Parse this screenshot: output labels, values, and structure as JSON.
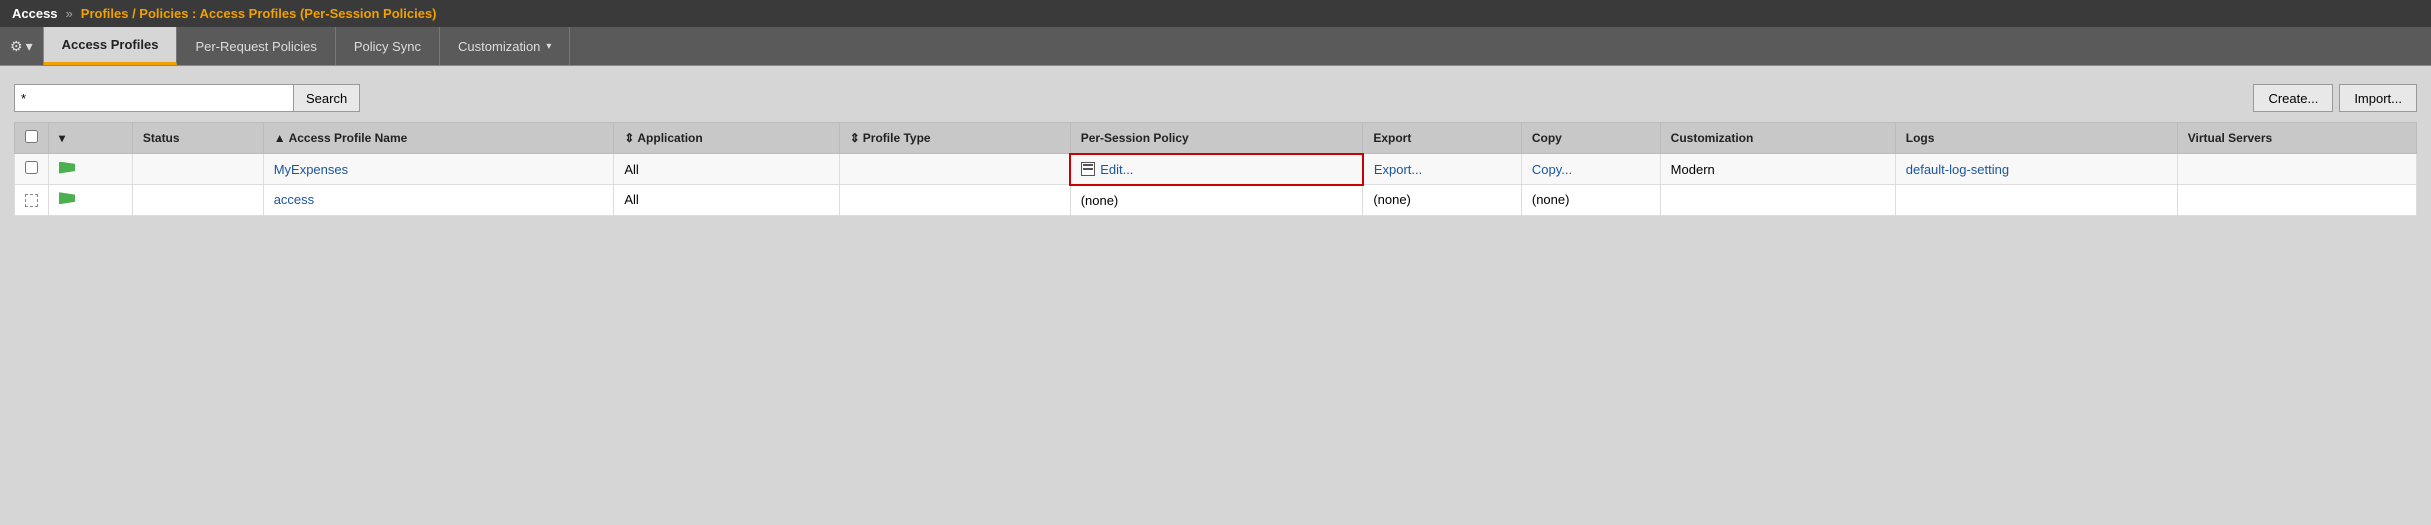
{
  "header": {
    "app_label": "Access",
    "chevrons": "»",
    "breadcrumb": "Profiles / Policies : Access Profiles (Per-Session Policies)"
  },
  "tabs": {
    "gear_label": "⚙",
    "dropdown_arrow": "▾",
    "items": [
      {
        "id": "access-profiles",
        "label": "Access Profiles",
        "active": true
      },
      {
        "id": "per-request-policies",
        "label": "Per-Request Policies",
        "active": false
      },
      {
        "id": "policy-sync",
        "label": "Policy Sync",
        "active": false
      },
      {
        "id": "customization",
        "label": "Customization",
        "active": false,
        "has_dropdown": true
      }
    ]
  },
  "search": {
    "input_value": "*",
    "input_placeholder": "",
    "search_button_label": "Search",
    "create_button_label": "Create...",
    "import_button_label": "Import..."
  },
  "table": {
    "columns": [
      {
        "id": "checkbox",
        "label": ""
      },
      {
        "id": "dropdown",
        "label": ""
      },
      {
        "id": "status",
        "label": "Status",
        "sortable": false
      },
      {
        "id": "access-profile-name",
        "label": "Access Profile Name",
        "sortable": true,
        "sort_dir": "asc"
      },
      {
        "id": "application",
        "label": "Application",
        "sortable": true,
        "sort_dir": ""
      },
      {
        "id": "profile-type",
        "label": "Profile Type",
        "sortable": true,
        "sort_dir": ""
      },
      {
        "id": "per-session-policy",
        "label": "Per-Session Policy",
        "sortable": false
      },
      {
        "id": "export",
        "label": "Export",
        "sortable": false
      },
      {
        "id": "copy",
        "label": "Copy",
        "sortable": false
      },
      {
        "id": "customization",
        "label": "Customization",
        "sortable": false
      },
      {
        "id": "logs",
        "label": "Logs",
        "sortable": false
      },
      {
        "id": "virtual-servers",
        "label": "Virtual Servers",
        "sortable": false
      }
    ],
    "rows": [
      {
        "checkbox": false,
        "status": "active",
        "name": "MyExpenses",
        "application": "All",
        "profile_type": "",
        "per_session_policy": "Edit...",
        "per_session_policy_highlighted": true,
        "export": "Export...",
        "copy": "Copy...",
        "customization": "Modern",
        "logs": "default-log-setting",
        "virtual_servers": ""
      },
      {
        "checkbox": false,
        "status": "active",
        "name": "access",
        "application": "All",
        "profile_type": "",
        "per_session_policy": "(none)",
        "per_session_policy_highlighted": false,
        "export": "(none)",
        "copy": "(none)",
        "customization": "",
        "logs": "",
        "virtual_servers": ""
      }
    ]
  }
}
